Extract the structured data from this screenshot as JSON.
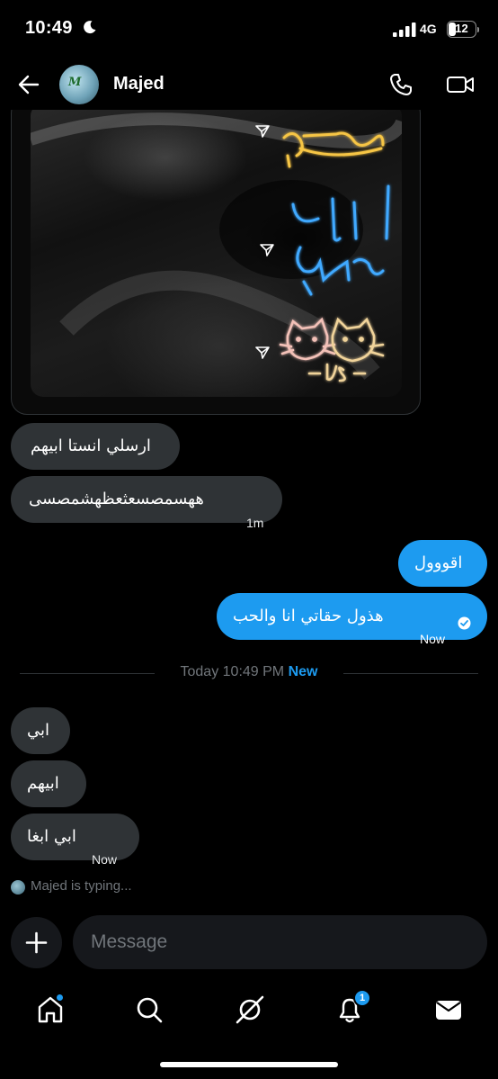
{
  "status_bar": {
    "time": "10:49",
    "network": "4G",
    "battery": "12"
  },
  "header": {
    "contact_name": "Majed",
    "avatar_text": "M"
  },
  "messages_before": [
    {
      "text": "ارسلي انستا ابيهم",
      "time": ""
    },
    {
      "text": "ههسمصسعثعظهشمصسى",
      "time": "1m"
    }
  ],
  "messages_sent": [
    {
      "text": "اقووول",
      "time": ""
    },
    {
      "text": "هذول حقاتي انا والحب",
      "time": "Now"
    }
  ],
  "divider": {
    "text": "Today 10:49 PM",
    "new_label": "New"
  },
  "messages_after": [
    {
      "text": "ابي",
      "time": ""
    },
    {
      "text": "ابيهم",
      "time": ""
    },
    {
      "text": "ابي ابغا",
      "time": "Now"
    }
  ],
  "typing_indicator": "Majed is typing...",
  "composer": {
    "placeholder": "Message"
  },
  "nav": {
    "notifications_badge": "1"
  },
  "colors": {
    "accent": "#1d9bf0",
    "incoming_bubble": "#2f3336",
    "background": "#000000"
  },
  "icons": [
    "moon-icon",
    "signal-icon",
    "back-arrow-icon",
    "phone-icon",
    "video-icon",
    "share-icon",
    "read-check-icon",
    "plus-icon",
    "home-icon",
    "search-icon",
    "grok-icon",
    "bell-icon",
    "mail-icon"
  ]
}
